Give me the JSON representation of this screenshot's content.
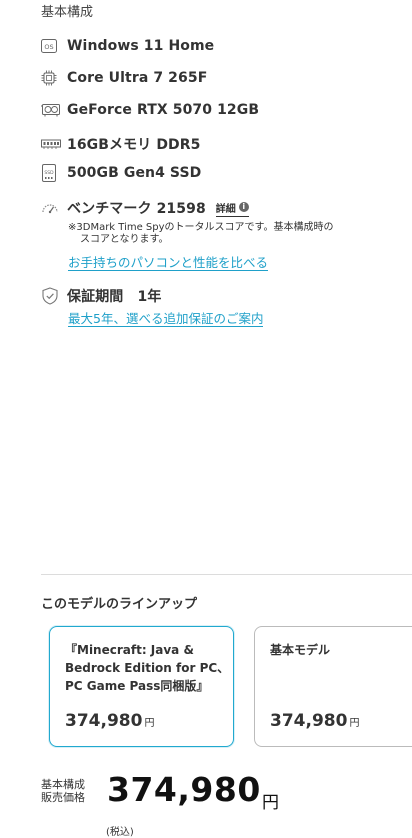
{
  "section_title": "基本構成",
  "specs": {
    "os": "Windows 11 Home",
    "cpu": "Core Ultra 7 265F",
    "gpu": "GeForce RTX 5070 12GB",
    "memory": "16GBメモリ DDR5",
    "storage": "500GB Gen4 SSD"
  },
  "benchmark": {
    "label": "ベンチマーク 21598",
    "detail_label": "詳細",
    "note_line1": "※3DMark Time Spyのトータルスコアです。基本構成時の",
    "note_line2": "スコアとなります。",
    "compare_link": "お手持ちのパソコンと性能を比べる"
  },
  "warranty": {
    "label": "保証期間　1年",
    "link": "最大5年、選べる追加保証のご案内"
  },
  "lineup": {
    "title": "このモデルのラインアップ",
    "cards": [
      {
        "name_line1": "『Minecraft: Java &",
        "name_line2": "Bedrock Edition for PC、",
        "name_line3": "PC Game Pass同梱版』",
        "price": "374,980",
        "yen": "円",
        "selected": true
      },
      {
        "name_line1": "基本モデル",
        "price": "374,980",
        "yen": "円",
        "selected": false
      }
    ]
  },
  "price": {
    "label_line1": "基本構成",
    "label_line2": "販売価格",
    "value": "374,980",
    "yen": "円",
    "bottom_fragment": "(税込)"
  },
  "colors": {
    "accent": "#1fa0c9",
    "text": "#333333"
  }
}
